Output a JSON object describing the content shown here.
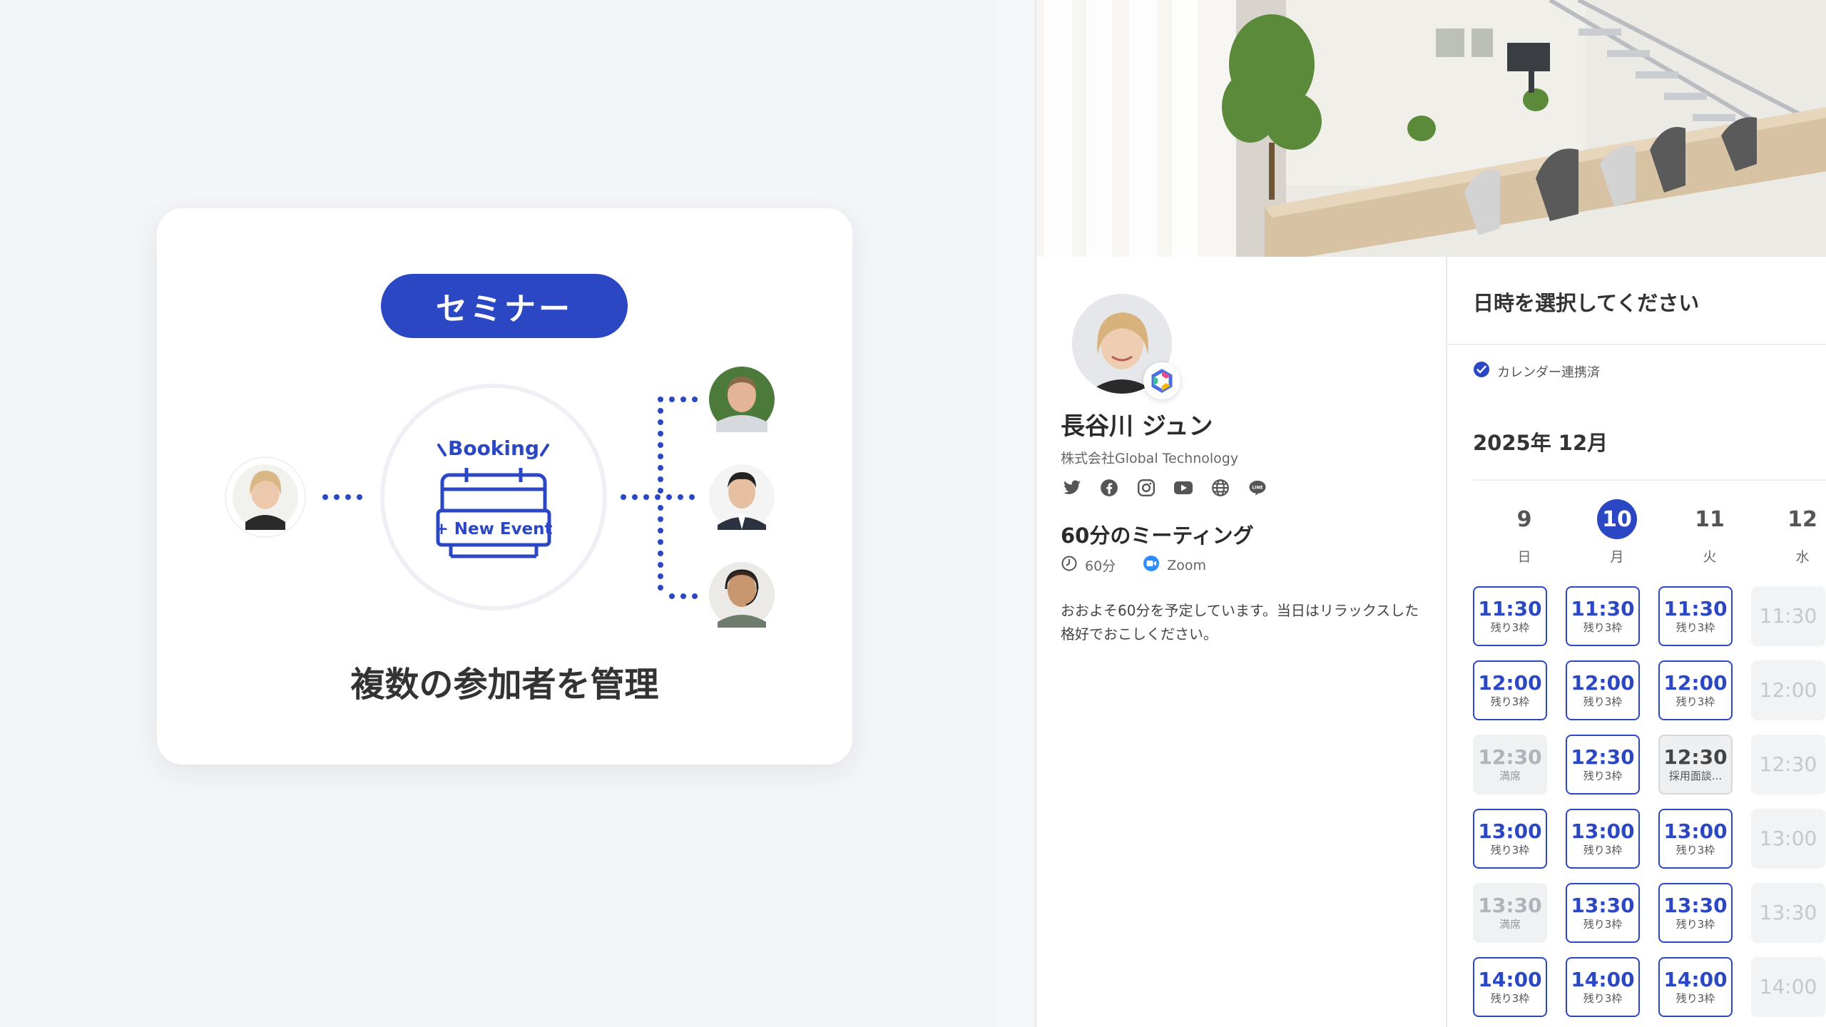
{
  "left_card": {
    "badge": "セミナー",
    "booking_label": "Booking",
    "new_event_label": "+ New Event",
    "caption": "複数の参加者を管理"
  },
  "profile": {
    "name": "長谷川 ジュン",
    "company": "株式会社Global Technology",
    "socials": [
      "twitter-icon",
      "facebook-icon",
      "instagram-icon",
      "youtube-icon",
      "globe-icon",
      "line-icon"
    ],
    "meeting_title": "60分のミーティング",
    "duration": "60分",
    "platform": "Zoom",
    "description": "おおよそ60分を予定しています。当日はリラックスした格好でおこしください。"
  },
  "schedule": {
    "title": "日時を選択してください",
    "sync_label": "カレンダー連携済",
    "month": "2025年 12月",
    "days": [
      {
        "num": "9",
        "weekday": "日"
      },
      {
        "num": "10",
        "weekday": "月"
      },
      {
        "num": "11",
        "weekday": "火"
      },
      {
        "num": "12",
        "weekday": "水"
      }
    ],
    "rows": [
      [
        {
          "t": "11:30",
          "s": "残り3枠",
          "state": "avail"
        },
        {
          "t": "11:30",
          "s": "残り3枠",
          "state": "avail"
        },
        {
          "t": "11:30",
          "s": "残り3枠",
          "state": "avail"
        },
        {
          "t": "11:30",
          "s": "",
          "state": "off"
        }
      ],
      [
        {
          "t": "12:00",
          "s": "残り3枠",
          "state": "avail"
        },
        {
          "t": "12:00",
          "s": "残り3枠",
          "state": "avail"
        },
        {
          "t": "12:00",
          "s": "残り3枠",
          "state": "avail"
        },
        {
          "t": "12:00",
          "s": "",
          "state": "off"
        }
      ],
      [
        {
          "t": "12:30",
          "s": "満席",
          "state": "full"
        },
        {
          "t": "12:30",
          "s": "残り3枠",
          "state": "avail"
        },
        {
          "t": "12:30",
          "s": "採用面談...",
          "state": "busy"
        },
        {
          "t": "12:30",
          "s": "",
          "state": "off"
        }
      ],
      [
        {
          "t": "13:00",
          "s": "残り3枠",
          "state": "avail"
        },
        {
          "t": "13:00",
          "s": "残り3枠",
          "state": "avail"
        },
        {
          "t": "13:00",
          "s": "残り3枠",
          "state": "avail"
        },
        {
          "t": "13:00",
          "s": "",
          "state": "off"
        }
      ],
      [
        {
          "t": "13:30",
          "s": "満席",
          "state": "full"
        },
        {
          "t": "13:30",
          "s": "残り3枠",
          "state": "avail"
        },
        {
          "t": "13:30",
          "s": "残り3枠",
          "state": "avail"
        },
        {
          "t": "13:30",
          "s": "",
          "state": "off"
        }
      ],
      [
        {
          "t": "14:00",
          "s": "残り3枠",
          "state": "avail"
        },
        {
          "t": "14:00",
          "s": "残り3枠",
          "state": "avail"
        },
        {
          "t": "14:00",
          "s": "残り3枠",
          "state": "avail"
        },
        {
          "t": "14:00",
          "s": "",
          "state": "off"
        }
      ]
    ]
  },
  "colors": {
    "accent": "#2b47c4",
    "disabled": "#f0f1f3"
  }
}
